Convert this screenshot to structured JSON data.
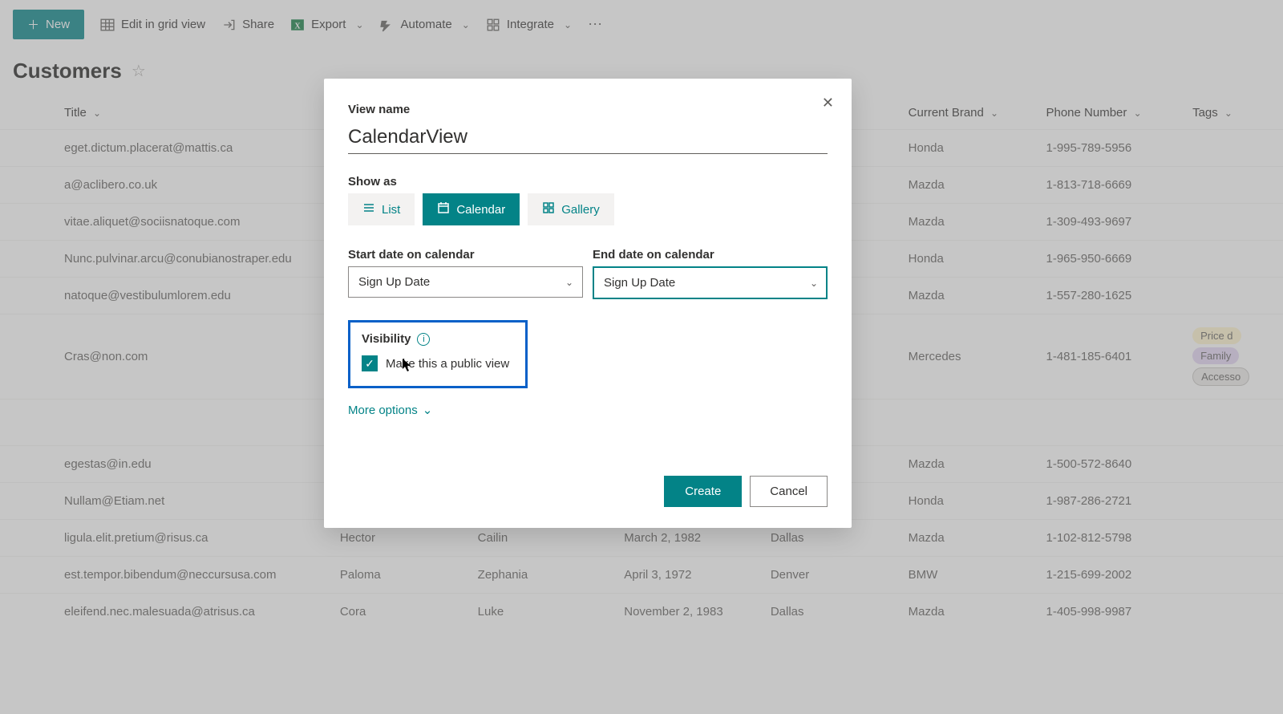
{
  "toolbar": {
    "new_label": "New",
    "edit_grid": "Edit in grid view",
    "share": "Share",
    "export": "Export",
    "automate": "Automate",
    "integrate": "Integrate"
  },
  "page": {
    "title": "Customers"
  },
  "columns": {
    "title": "Title",
    "first_name": "",
    "last_name": "",
    "birth_date": "",
    "city": "",
    "current_brand": "Current Brand",
    "phone": "Phone Number",
    "tags": "Tags"
  },
  "rows": [
    {
      "title": "eget.dictum.placerat@mattis.ca",
      "fn": "",
      "ln": "",
      "bd": "",
      "city": "",
      "brand": "Honda",
      "phone": "1-995-789-5956",
      "tags": []
    },
    {
      "title": "a@aclibero.co.uk",
      "fn": "",
      "ln": "",
      "bd": "",
      "city": "",
      "brand": "Mazda",
      "phone": "1-813-718-6669",
      "tags": []
    },
    {
      "title": "vitae.aliquet@sociisnatoque.com",
      "fn": "",
      "ln": "",
      "bd": "",
      "city": "",
      "brand": "Mazda",
      "phone": "1-309-493-9697",
      "tags": []
    },
    {
      "title": "Nunc.pulvinar.arcu@conubianostraper.edu",
      "fn": "",
      "ln": "",
      "bd": "",
      "city": "",
      "brand": "Honda",
      "phone": "1-965-950-6669",
      "tags": []
    },
    {
      "title": "natoque@vestibulumlorem.edu",
      "fn": "",
      "ln": "",
      "bd": "",
      "city": "",
      "brand": "Mazda",
      "phone": "1-557-280-1625",
      "tags": []
    },
    {
      "title": "Cras@non.com",
      "fn": "",
      "ln": "",
      "bd": "",
      "city": "",
      "brand": "Mercedes",
      "phone": "1-481-185-6401",
      "tags": [
        "Price d",
        "Family",
        "Accesso"
      ]
    },
    {
      "title": "egestas@in.edu",
      "fn": "",
      "ln": "",
      "bd": "",
      "city": "",
      "brand": "Mazda",
      "phone": "1-500-572-8640",
      "tags": []
    },
    {
      "title": "Nullam@Etiam.net",
      "fn": "",
      "ln": "",
      "bd": "",
      "city": "",
      "brand": "Honda",
      "phone": "1-987-286-2721",
      "tags": []
    },
    {
      "title": "ligula.elit.pretium@risus.ca",
      "fn": "Hector",
      "ln": "Cailin",
      "bd": "March 2, 1982",
      "city": "Dallas",
      "brand": "Mazda",
      "phone": "1-102-812-5798",
      "tags": []
    },
    {
      "title": "est.tempor.bibendum@neccursusa.com",
      "fn": "Paloma",
      "ln": "Zephania",
      "bd": "April 3, 1972",
      "city": "Denver",
      "brand": "BMW",
      "phone": "1-215-699-2002",
      "tags": []
    },
    {
      "title": "eleifend.nec.malesuada@atrisus.ca",
      "fn": "Cora",
      "ln": "Luke",
      "bd": "November 2, 1983",
      "city": "Dallas",
      "brand": "Mazda",
      "phone": "1-405-998-9987",
      "tags": []
    }
  ],
  "dialog": {
    "view_name_label": "View name",
    "view_name_value": "CalendarView",
    "show_as_label": "Show as",
    "show_as": {
      "list": "List",
      "calendar": "Calendar",
      "gallery": "Gallery"
    },
    "start_date_label": "Start date on calendar",
    "start_date_value": "Sign Up Date",
    "end_date_label": "End date on calendar",
    "end_date_value": "Sign Up Date",
    "visibility_label": "Visibility",
    "visibility_checkbox_label": "Make this a public view",
    "visibility_checked": true,
    "more_options": "More options",
    "create": "Create",
    "cancel": "Cancel"
  }
}
